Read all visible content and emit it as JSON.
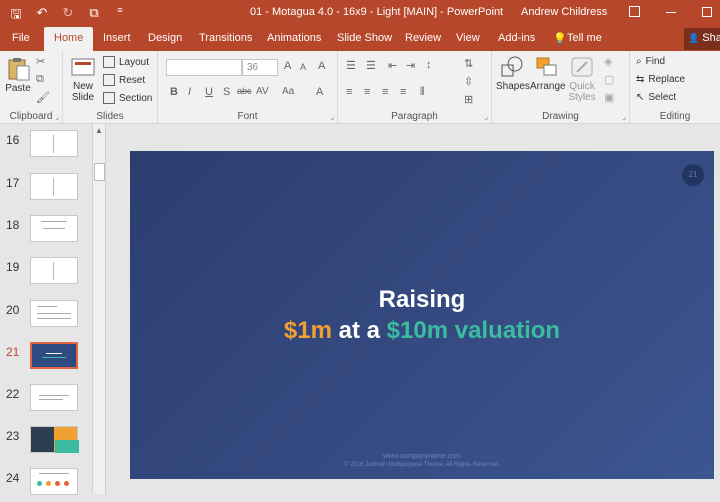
{
  "titlebar": {
    "doc_title": "01 - Motagua 4.0 - 16x9 - Light [MAIN]  -  PowerPoint",
    "user_name": "Andrew Childress",
    "minimize_glyph": "🗕",
    "restore_glyph": "☐",
    "qat": {
      "save_glyph": "🖫",
      "undo_glyph": "↶",
      "redo_glyph": "↻",
      "present_glyph": "⧉",
      "more_glyph": "≡"
    }
  },
  "tabs": [
    {
      "label": "File"
    },
    {
      "label": "Home"
    },
    {
      "label": "Insert"
    },
    {
      "label": "Design"
    },
    {
      "label": "Transitions"
    },
    {
      "label": "Animations"
    },
    {
      "label": "Slide Show"
    },
    {
      "label": "Review"
    },
    {
      "label": "View"
    },
    {
      "label": "Add-ins"
    },
    {
      "label": "Tell me"
    }
  ],
  "tell_me_glyph": "💡",
  "share_label": "Shar",
  "share_glyph": "👤",
  "ribbon": {
    "clipboard": {
      "paste": "Paste",
      "label": "Clipboard"
    },
    "slides": {
      "new_slide_line1": "New",
      "new_slide_line2": "Slide",
      "layout": "Layout",
      "reset": "Reset",
      "section": "Section",
      "label": "Slides"
    },
    "font": {
      "font_size": "36",
      "bold": "B",
      "italic": "I",
      "underline": "U",
      "shadow": "S",
      "strike": "abc",
      "spacing": "AV",
      "case": "Aa",
      "grow": "A",
      "shrink": "A",
      "clear": "A",
      "label": "Font"
    },
    "paragraph": {
      "label": "Paragraph"
    },
    "drawing": {
      "shapes": "Shapes",
      "arrange": "Arrange",
      "quick_line1": "Quick",
      "quick_line2": "Styles",
      "label": "Drawing"
    },
    "editing": {
      "find": "Find",
      "replace": "Replace",
      "select": "Select",
      "label": "Editing"
    }
  },
  "thumbnails": [
    {
      "num": "16"
    },
    {
      "num": "17"
    },
    {
      "num": "18"
    },
    {
      "num": "19"
    },
    {
      "num": "20"
    },
    {
      "num": "21"
    },
    {
      "num": "22"
    },
    {
      "num": "23"
    },
    {
      "num": "24"
    }
  ],
  "slide": {
    "number": "21",
    "title": "Raising",
    "amount1": "$1m",
    "middle": " at a ",
    "amount2": "$10m",
    "tail": " valuation",
    "footer_url": "www.companyname.com",
    "footer_copy": "© 2016 Jetbrain Multipurpose Theme. All Rights Reserved."
  },
  "colors": {
    "accent": "#b7472a",
    "slide_bg": "#34497f",
    "orange": "#f0a030",
    "teal": "#3bbca0"
  }
}
